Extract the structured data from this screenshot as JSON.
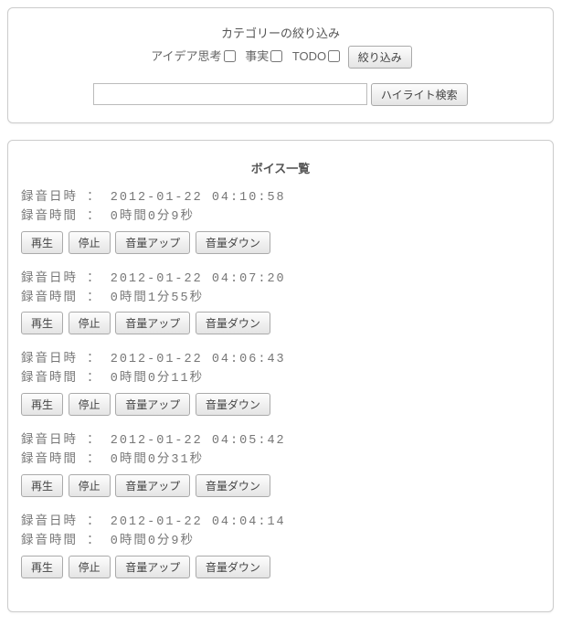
{
  "filter": {
    "title": "カテゴリーの絞り込み",
    "categories": [
      {
        "label": "アイデア思考"
      },
      {
        "label": "事実"
      },
      {
        "label": "TODO"
      }
    ],
    "submit": "絞り込み"
  },
  "search": {
    "value": "",
    "button": "ハイライト検索"
  },
  "list": {
    "title": "ボイス一覧",
    "meta_labels": {
      "datetime": "録音日時",
      "duration": "録音時間",
      "sep": "："
    },
    "buttons": {
      "play": "再生",
      "stop": "停止",
      "vol_up": "音量アップ",
      "vol_down": "音量ダウン"
    },
    "items": [
      {
        "datetime": "2012-01-22 04:10:58",
        "duration": "0時間0分9秒"
      },
      {
        "datetime": "2012-01-22 04:07:20",
        "duration": "0時間1分55秒"
      },
      {
        "datetime": "2012-01-22 04:06:43",
        "duration": "0時間0分11秒"
      },
      {
        "datetime": "2012-01-22 04:05:42",
        "duration": "0時間0分31秒"
      },
      {
        "datetime": "2012-01-22 04:04:14",
        "duration": "0時間0分9秒"
      }
    ]
  }
}
